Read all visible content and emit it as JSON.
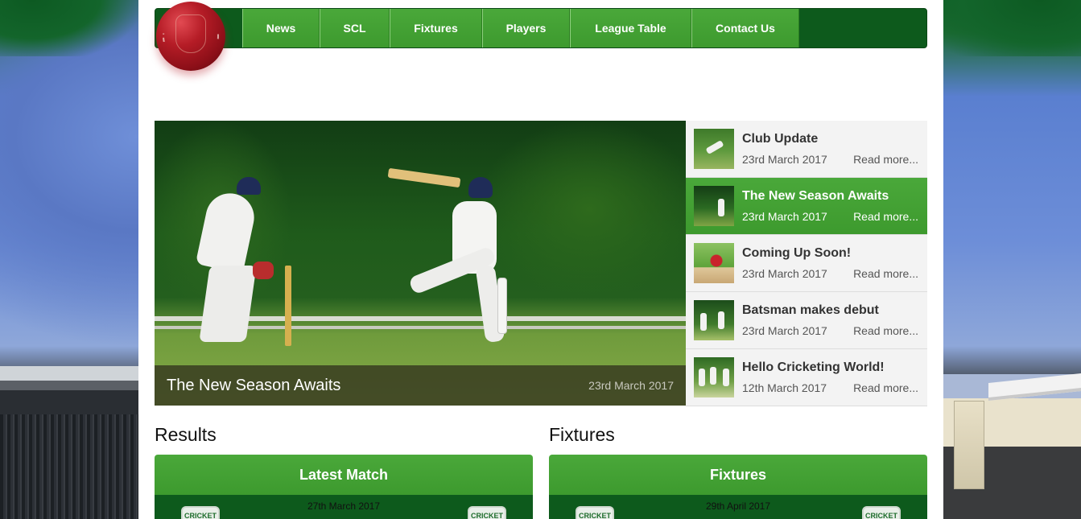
{
  "nav": {
    "items": [
      "News",
      "SCL",
      "Fixtures",
      "Players",
      "League Table",
      "Contact Us"
    ]
  },
  "hero": {
    "title": "The New Season Awaits",
    "date": "23rd March 2017"
  },
  "news": [
    {
      "title": "Club Update",
      "date": "23rd March 2017",
      "more": "Read more...",
      "active": false
    },
    {
      "title": "The New Season Awaits",
      "date": "23rd March 2017",
      "more": "Read more...",
      "active": true
    },
    {
      "title": "Coming Up Soon!",
      "date": "23rd March 2017",
      "more": "Read more...",
      "active": false
    },
    {
      "title": "Batsman makes debut",
      "date": "23rd March 2017",
      "more": "Read more...",
      "active": false
    },
    {
      "title": "Hello Cricketing World!",
      "date": "12th March 2017",
      "more": "Read more...",
      "active": false
    }
  ],
  "results": {
    "section_title": "Results",
    "panel_title": "Latest Match",
    "date": "27th March 2017",
    "badge_text": "CRICKET"
  },
  "fixtures": {
    "section_title": "Fixtures",
    "panel_title": "Fixtures",
    "date": "29th April 2017",
    "badge_text": "CRICKET"
  },
  "colors": {
    "nav_dark": "#0d5a1c",
    "accent_green": "#45a135",
    "caption_bg": "#32321e"
  },
  "icons": {
    "logo": "cricket-ball-logo"
  }
}
